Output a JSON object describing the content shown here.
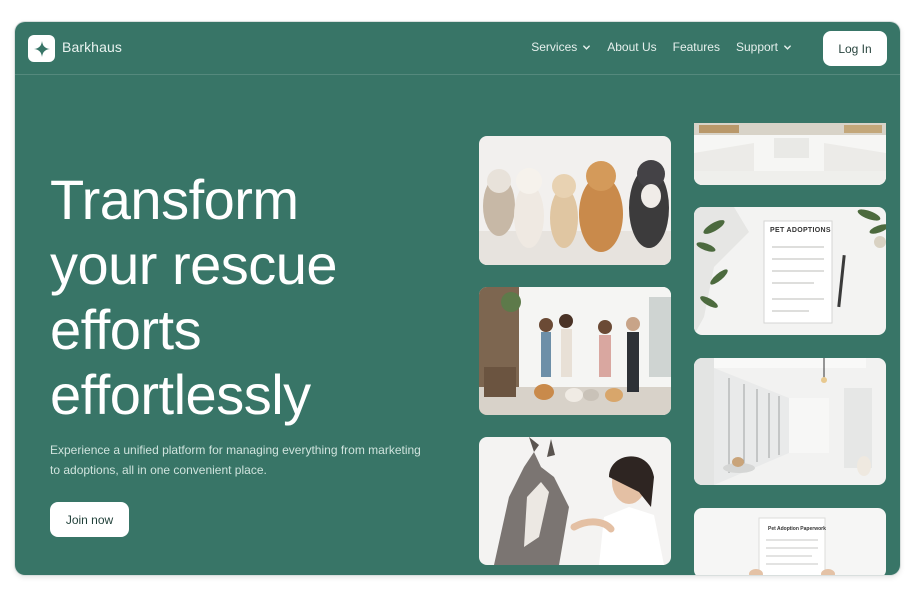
{
  "nav": {
    "brand": "Barkhaus",
    "items": [
      {
        "label": "Services",
        "has_dropdown": true
      },
      {
        "label": "About Us",
        "has_dropdown": false
      },
      {
        "label": "Features",
        "has_dropdown": false
      },
      {
        "label": "Support",
        "has_dropdown": true
      }
    ],
    "login_label": "Log In"
  },
  "hero": {
    "headline_lines": [
      "Transform",
      "your rescue",
      "efforts",
      "effortlessly"
    ],
    "subtext": "Experience a unified platform for managing everything from marketing to adoptions, all in one convenient place.",
    "cta_label": "Join now"
  },
  "gallery": {
    "doc_title_1": "PET ADOPTIONS",
    "doc_title_2": "Pet Adoption Paperwork"
  },
  "colors": {
    "background": "#387567",
    "text_primary": "#ffffff",
    "button_bg": "#ffffff"
  }
}
